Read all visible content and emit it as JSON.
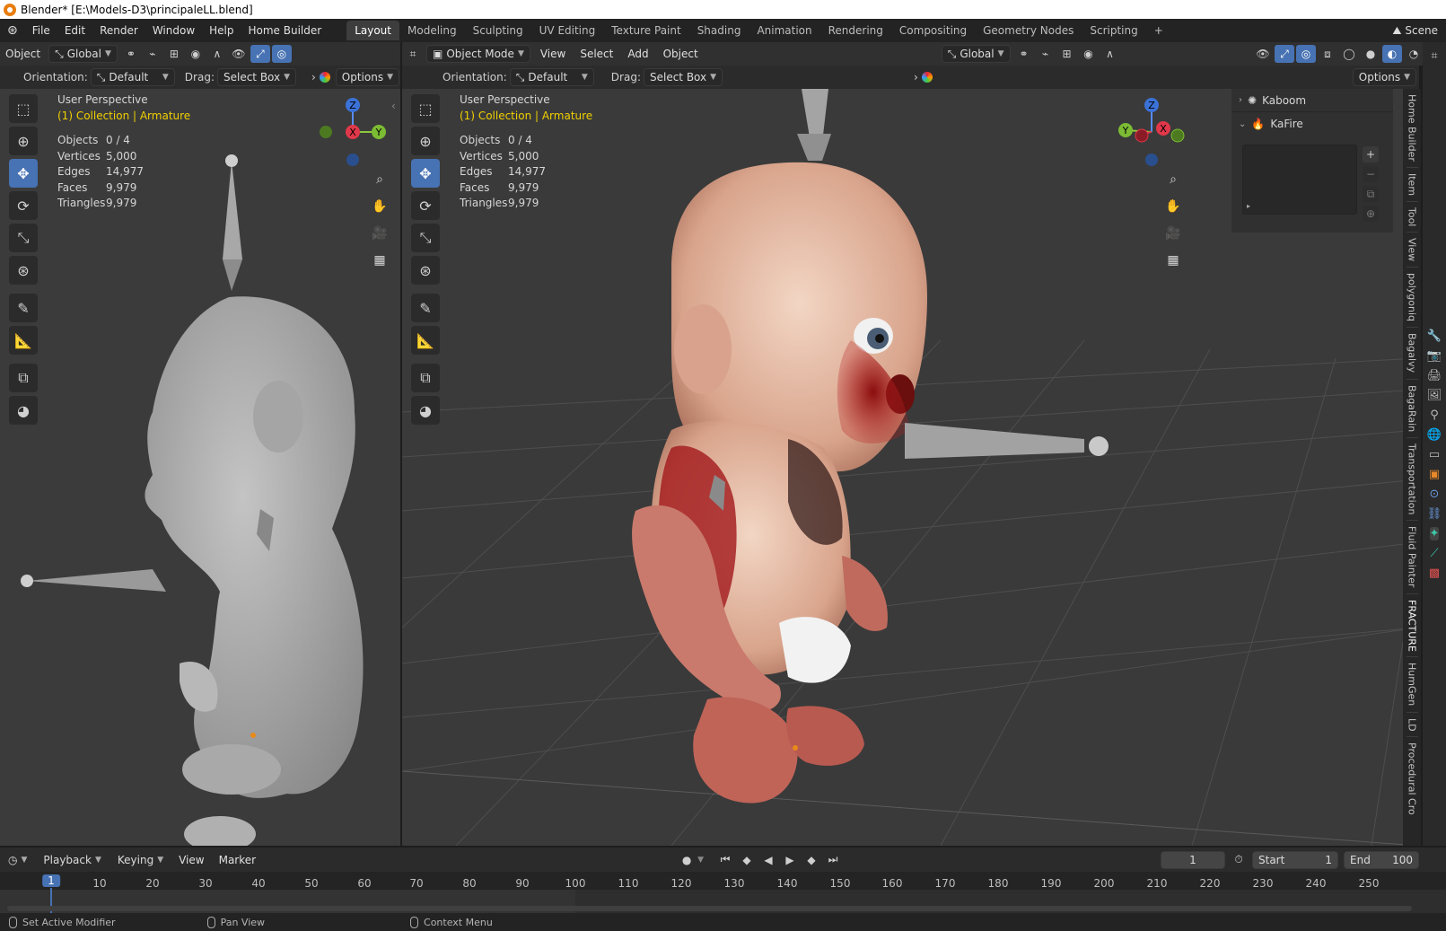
{
  "window": {
    "title": "Blender* [E:\\Models-D3\\principaleLL.blend]"
  },
  "menu": [
    "File",
    "Edit",
    "Render",
    "Window",
    "Help",
    "Home Builder"
  ],
  "workspaces": [
    "Layout",
    "Modeling",
    "Sculpting",
    "UV Editing",
    "Texture Paint",
    "Shading",
    "Animation",
    "Rendering",
    "Compositing",
    "Geometry Nodes",
    "Scripting"
  ],
  "active_workspace": "Layout",
  "scene": "Scene",
  "left_header": {
    "mode": "Object",
    "transform": "Global"
  },
  "left_header2": {
    "orientation_label": "Orientation:",
    "orientation": "Default",
    "drag_label": "Drag:",
    "drag": "Select Box",
    "options": "Options"
  },
  "right_header": {
    "mode": "Object Mode",
    "view": "View",
    "select": "Select",
    "add": "Add",
    "object": "Object",
    "transform": "Global"
  },
  "right_header2": {
    "orientation_label": "Orientation:",
    "orientation": "Default",
    "drag_label": "Drag:",
    "drag": "Select Box",
    "options": "Options"
  },
  "viewport_info": {
    "perspective": "User Perspective",
    "collection": "(1) Collection | Armature"
  },
  "stats": [
    {
      "label": "Objects",
      "value": "0 / 4"
    },
    {
      "label": "Vertices",
      "value": "5,000"
    },
    {
      "label": "Edges",
      "value": "14,977"
    },
    {
      "label": "Faces",
      "value": "9,979"
    },
    {
      "label": "Triangles",
      "value": "9,979"
    }
  ],
  "gizmo": {
    "z": "Z",
    "x": "X",
    "y": "Y"
  },
  "npanel": {
    "items": [
      {
        "label": "Kaboom"
      },
      {
        "label": "KaFire"
      }
    ]
  },
  "side_tabs": [
    "Home Builder",
    "Item",
    "Tool",
    "View",
    "polygoniq",
    "Bagalvy",
    "BagaRain",
    "Transportation",
    "Fluid Painter",
    "FRACTURE",
    "HumGen",
    "LD",
    "Procedural Cro"
  ],
  "timeline": {
    "menus": [
      "Playback",
      "Keying",
      "View",
      "Marker"
    ],
    "current_frame": "1",
    "start_label": "Start",
    "start": "1",
    "end_label": "End",
    "end": "100",
    "ruler": [
      "1",
      "10",
      "20",
      "30",
      "40",
      "50",
      "60",
      "70",
      "80",
      "90",
      "100",
      "110",
      "120",
      "130",
      "140",
      "150",
      "160",
      "170",
      "180",
      "190",
      "200",
      "210",
      "220",
      "230",
      "240",
      "250"
    ]
  },
  "statusbar": [
    {
      "label": "Set Active Modifier"
    },
    {
      "label": "Pan View"
    },
    {
      "label": "Context Menu"
    }
  ]
}
